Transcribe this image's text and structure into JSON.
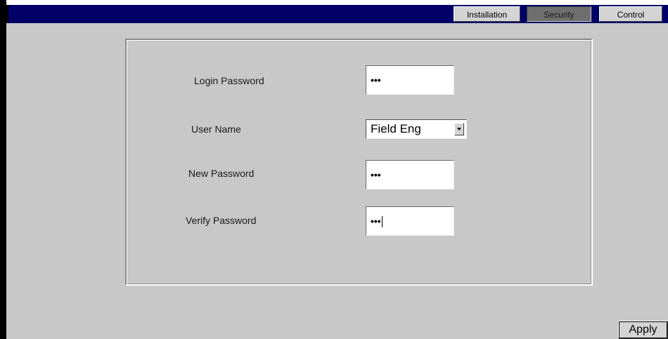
{
  "tabs": [
    {
      "label": "Installation",
      "active": false
    },
    {
      "label": "Security",
      "active": true
    },
    {
      "label": "Control",
      "active": false
    }
  ],
  "form": {
    "login_password": {
      "label": "Login Password",
      "value": "•••"
    },
    "user_name": {
      "label": "User Name",
      "selected": "Field Eng"
    },
    "new_password": {
      "label": "New Password",
      "value": "•••"
    },
    "verify_password": {
      "label": "Verify Password",
      "value": "•••"
    }
  },
  "apply_label": "Apply",
  "colors": {
    "header": "#000066",
    "background": "#c8c8c8",
    "tab": "#d4d4d4",
    "active_tab": "#6e6e6e"
  }
}
